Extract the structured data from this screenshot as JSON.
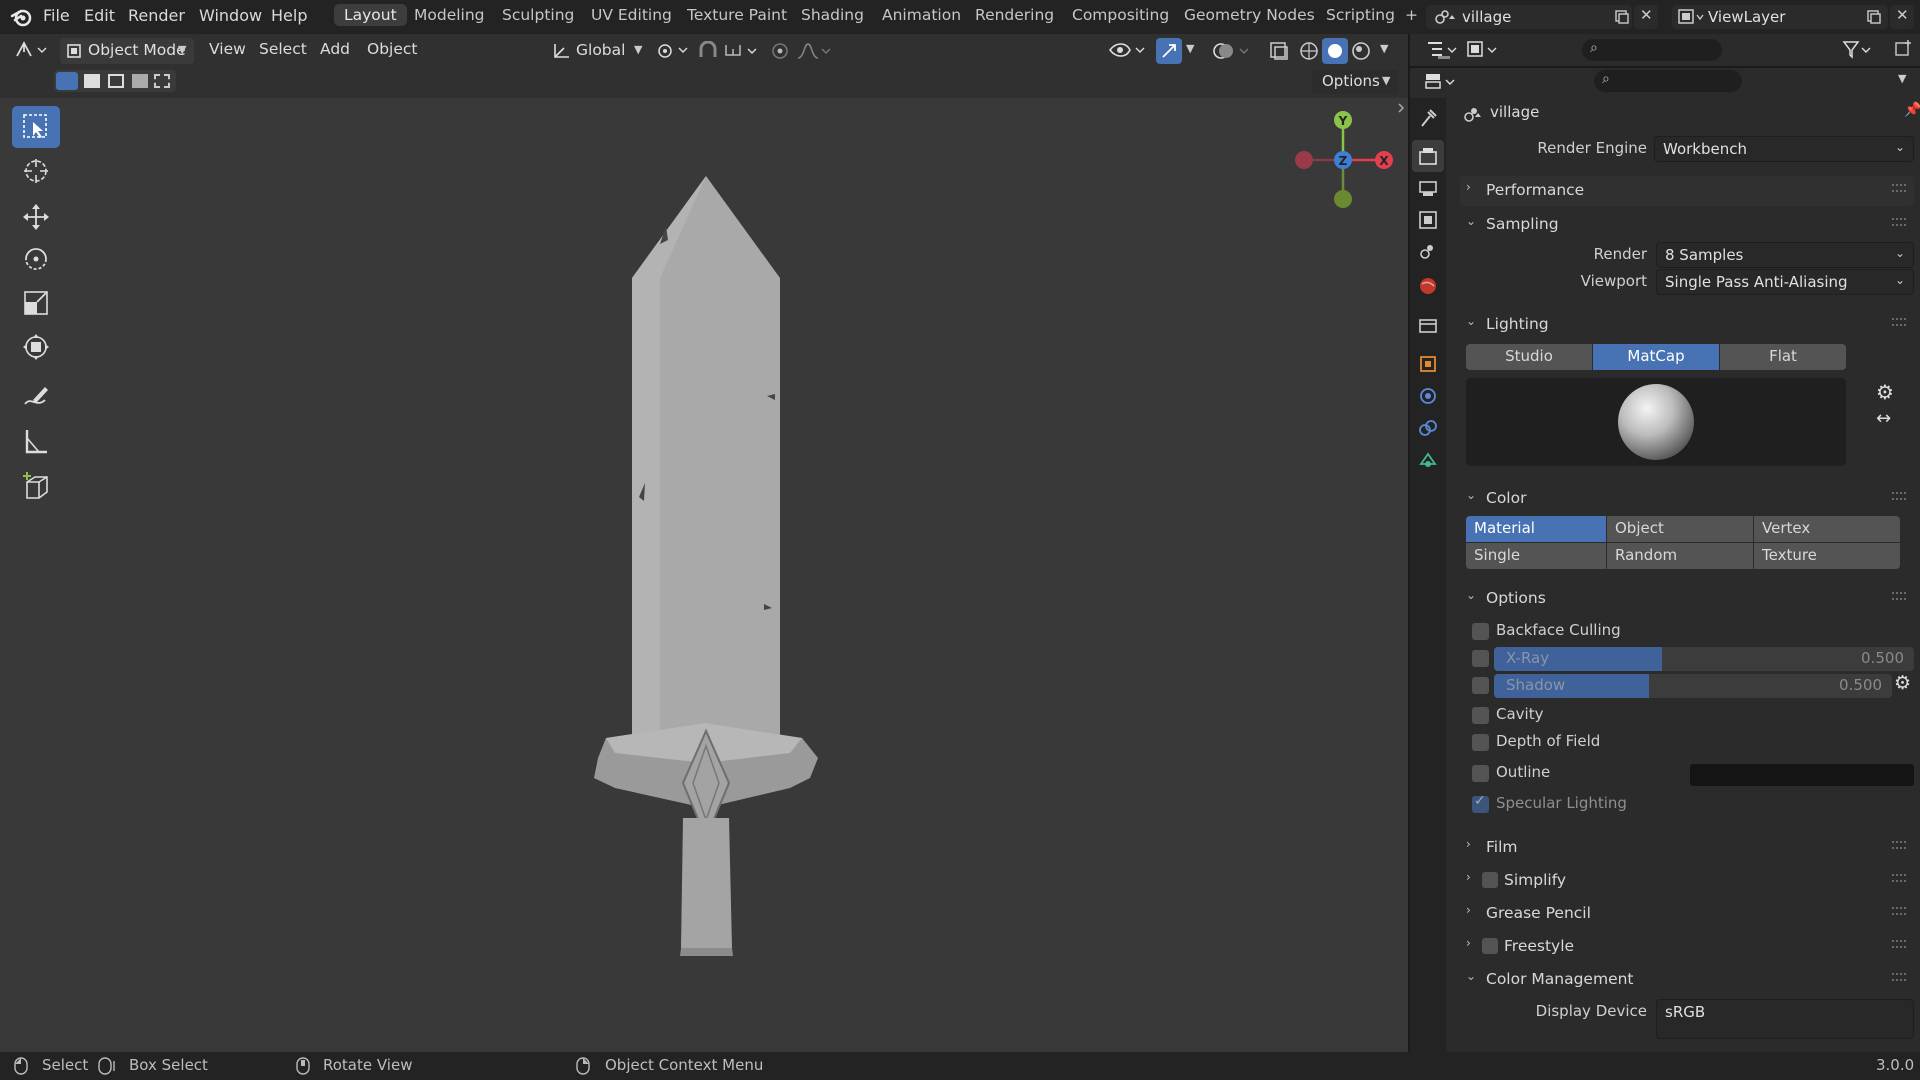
{
  "menubar": {
    "items": [
      "File",
      "Edit",
      "Render",
      "Window",
      "Help"
    ],
    "workspaces": [
      "Layout",
      "Modeling",
      "Sculpting",
      "UV Editing",
      "Texture Paint",
      "Shading",
      "Animation",
      "Rendering",
      "Compositing",
      "Geometry Nodes",
      "Scripting"
    ],
    "active_workspace": "Layout",
    "add_tab": "+",
    "scene_name": "village",
    "view_layer": "ViewLayer"
  },
  "viewport_header": {
    "mode": "Object Mode",
    "menus": [
      "View",
      "Select",
      "Add",
      "Object"
    ],
    "transform_orientation": "Global",
    "options_label": "Options"
  },
  "gizmo": {
    "x": "X",
    "y": "Y",
    "z": "Z"
  },
  "properties": {
    "scene_name": "village",
    "render_engine_label": "Render Engine",
    "render_engine": "Workbench",
    "sections": {
      "performance": "Performance",
      "sampling": "Sampling",
      "lighting": "Lighting",
      "color": "Color",
      "options": "Options",
      "film": "Film",
      "simplify": "Simplify",
      "grease_pencil": "Grease Pencil",
      "freestyle": "Freestyle",
      "color_management": "Color Management"
    },
    "sampling": {
      "render_label": "Render",
      "render_value": "8 Samples",
      "viewport_label": "Viewport",
      "viewport_value": "Single Pass Anti-Aliasing"
    },
    "lighting": {
      "options": [
        "Studio",
        "MatCap",
        "Flat"
      ],
      "active": "MatCap"
    },
    "color": {
      "options": [
        "Material",
        "Object",
        "Vertex",
        "Single",
        "Random",
        "Texture"
      ],
      "active": "Material"
    },
    "options": {
      "backface_culling": "Backface Culling",
      "xray": "X-Ray",
      "xray_value": "0.500",
      "xray_fraction": 0.5,
      "shadow": "Shadow",
      "shadow_value": "0.500",
      "shadow_fraction": 0.5,
      "cavity": "Cavity",
      "dof": "Depth of Field",
      "outline": "Outline",
      "specular": "Specular Lighting"
    },
    "display_device_label": "Display Device",
    "display_device": "sRGB"
  },
  "status": {
    "select": "Select",
    "box_select": "Box Select",
    "rotate_view": "Rotate View",
    "context_menu": "Object Context Menu",
    "version": "3.0.0"
  },
  "colors": {
    "accent": "#4772b3",
    "x_axis": "#e0404f",
    "y_axis": "#8bc34a",
    "z_axis": "#3d7fd6"
  }
}
